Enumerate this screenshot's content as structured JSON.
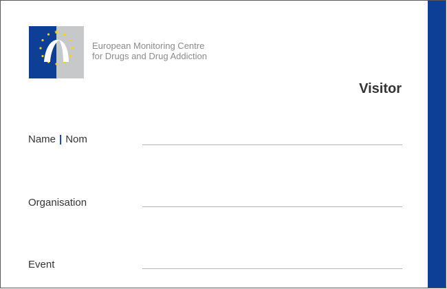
{
  "organization": {
    "name_line1": "European Monitoring Centre",
    "name_line2": "for Drugs and Drug Addiction"
  },
  "badge": {
    "title": "Visitor"
  },
  "fields": {
    "name_label_en": "Name",
    "name_separator": "|",
    "name_label_fr": "Nom",
    "organisation_label": "Organisation",
    "event_label": "Event"
  },
  "colors": {
    "brand_blue": "#0d3f97",
    "logo_grey": "#c7c8ca",
    "star_yellow": "#ffd200",
    "text_dark": "#333333",
    "text_grey": "#8a8a8a"
  },
  "icons": {
    "logo": "emcdda-eu-stars-arch-logo"
  }
}
